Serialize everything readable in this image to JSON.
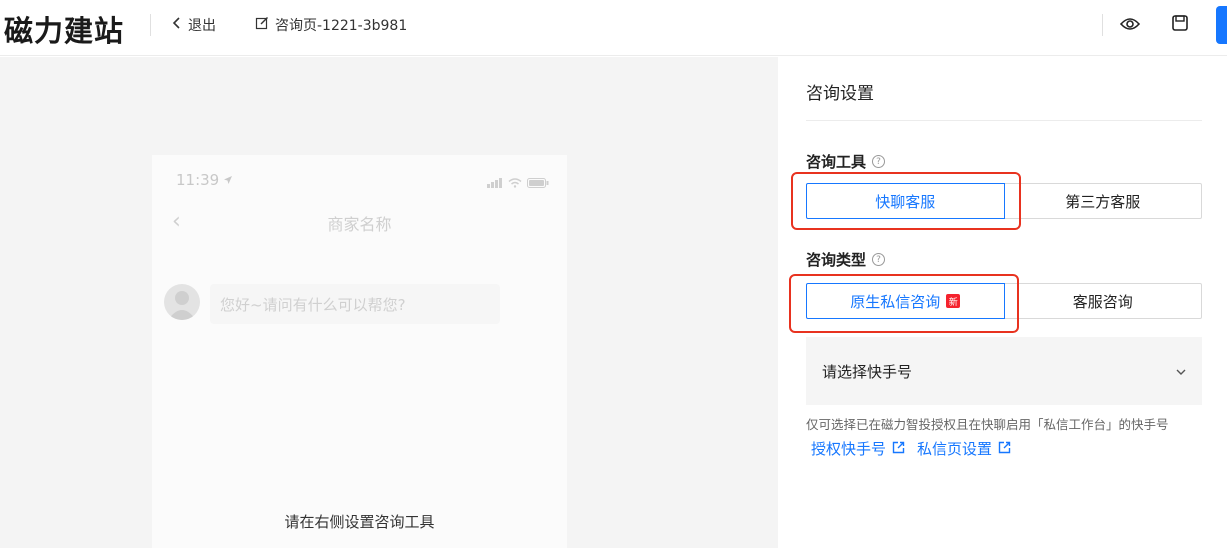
{
  "header": {
    "logo": "磁力建站",
    "exit_label": "退出",
    "page_name": "咨询页-1221-3b981"
  },
  "phone": {
    "time": "11:39",
    "merchant_name": "商家名称",
    "greeting": "您好~请问有什么可以帮您?",
    "hint": "请在右侧设置咨询工具"
  },
  "panel": {
    "title": "咨询设置",
    "tool_section": {
      "label": "咨询工具",
      "options": [
        "快聊客服",
        "第三方客服"
      ],
      "selected": "快聊客服"
    },
    "type_section": {
      "label": "咨询类型",
      "options": [
        "原生私信咨询",
        "客服咨询"
      ],
      "selected": "原生私信咨询",
      "badge": "新"
    },
    "select": {
      "placeholder": "请选择快手号"
    },
    "note": "仅可选择已在磁力智投授权且在快聊启用「私信工作台」的快手号",
    "links": [
      "授权快手号",
      "私信页设置"
    ]
  },
  "colors": {
    "accent": "#1677ff",
    "highlight_box": "#e8321f",
    "badge": "#f5222d"
  }
}
